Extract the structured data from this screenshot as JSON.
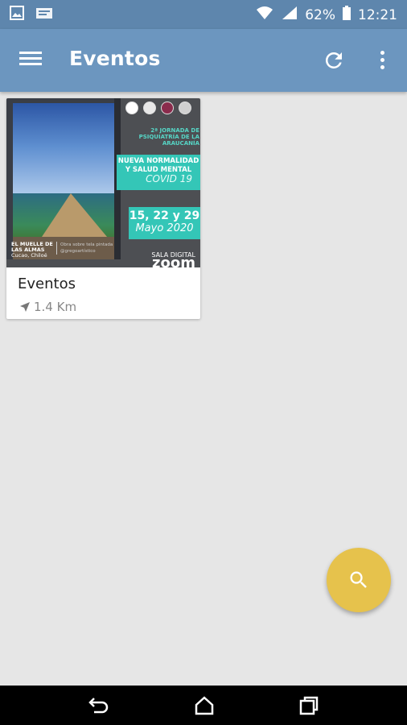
{
  "status_bar": {
    "battery": "62%",
    "time": "12:21",
    "icons": [
      "image-icon",
      "notification-icon",
      "wifi-icon",
      "signal-icon",
      "battery-icon"
    ]
  },
  "app_bar": {
    "title": "Eventos",
    "icons": [
      "menu-icon",
      "refresh-icon",
      "more-vert-icon"
    ],
    "color": "#6c96bf"
  },
  "cards": [
    {
      "title": "Eventos",
      "distance": "1.4 Km",
      "poster": {
        "heading": "2ª JORNADA DE PSIQUIATRÍA DE LA ARAUCANÍA",
        "band_line1": "NUEVA NORMALIDAD",
        "band_line2": "Y SALUD MENTAL",
        "band_line3": "COVID 19",
        "dates_line1": "15, 22 y 29",
        "dates_line2": "Mayo 2020",
        "sala_line1": "SALA DIGITAL",
        "sala_line2": "zoom",
        "artwork_line1": "EL MUELLE DE",
        "artwork_line2": "LAS ALMAS",
        "artwork_line3": "Cucao, Chiloé",
        "credit_line1": "Obra sobre tela pintada",
        "credit_line2": "@gregoartístico"
      }
    }
  ],
  "fab": {
    "icon": "search-icon",
    "color": "#e6c24c"
  },
  "nav_bar": {
    "icons": [
      "back-icon",
      "home-icon",
      "recents-icon"
    ]
  }
}
